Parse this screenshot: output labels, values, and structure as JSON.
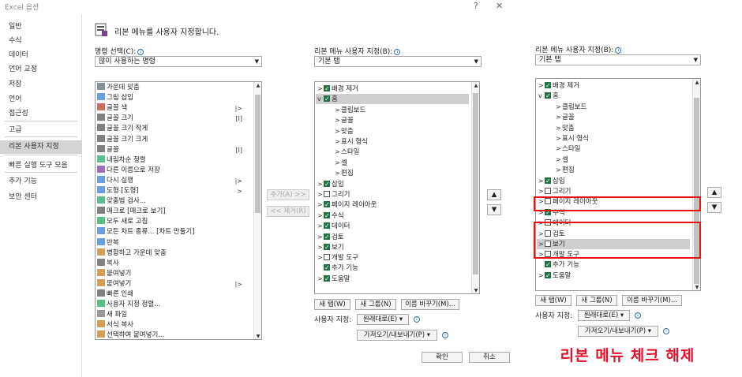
{
  "window": {
    "title": "Excel 옵션",
    "help": "?",
    "close": "✕"
  },
  "sidebar": {
    "items": [
      "일반",
      "수식",
      "데이터",
      "언어 교정",
      "저장",
      "언어",
      "접근성",
      "고급",
      "리본 사용자 지정",
      "빠른 실행 도구 모음",
      "추가 기능",
      "보안 센터"
    ],
    "selected": 8
  },
  "header": {
    "text": "리본 메뉴를 사용자 지정합니다."
  },
  "commands": {
    "label": "명령 선택(C):",
    "combo": "많이 사용하는 명령",
    "items": [
      "가운데 맞춤",
      "그림 삽입",
      "글꼴 색",
      "글꼴 크기",
      "글꼴 크기 작게",
      "글꼴 크기 크게",
      "글꼴",
      "내림차순 정렬",
      "다른 이름으로 저장",
      "다시 실행",
      "도형 [도형]",
      "맞춤법 검사...",
      "매크로 [매크로 보기]",
      "모두 새로 고침",
      "모든 차트 종류... [차트 만들기]",
      "반복",
      "병합하고 가운데 맞춤",
      "복사",
      "붙여넣기",
      "붙여넣기",
      "빠른 인쇄",
      "사용자 지정 정렬...",
      "새 파일",
      "서식 복사",
      "선택하여 붙여넣기..."
    ]
  },
  "middle": {
    "add_btn": "추가(A) >>",
    "remove_btn": "<< 제거(R)"
  },
  "ribbon_left": {
    "label": "리본 메뉴 사용자 지정(B):",
    "combo": "기본 탭",
    "items": [
      {
        "t": "배경 제거",
        "lvl": 0,
        "cb": true,
        "exp": ">"
      },
      {
        "t": "홈",
        "lvl": 0,
        "cb": true,
        "exp": "v",
        "sel": true
      },
      {
        "t": "클립보드",
        "lvl": 1
      },
      {
        "t": "글꼴",
        "lvl": 1
      },
      {
        "t": "맞춤",
        "lvl": 1
      },
      {
        "t": "표시 형식",
        "lvl": 1
      },
      {
        "t": "스타일",
        "lvl": 1
      },
      {
        "t": "셀",
        "lvl": 1
      },
      {
        "t": "편집",
        "lvl": 1
      },
      {
        "t": "삽입",
        "lvl": 0,
        "cb": true,
        "exp": ">"
      },
      {
        "t": "그리기",
        "lvl": 0,
        "cb": false,
        "exp": ">"
      },
      {
        "t": "페이지 레이아웃",
        "lvl": 0,
        "cb": true,
        "exp": ">"
      },
      {
        "t": "수식",
        "lvl": 0,
        "cb": true,
        "exp": ">"
      },
      {
        "t": "데이터",
        "lvl": 0,
        "cb": true,
        "exp": ">"
      },
      {
        "t": "검토",
        "lvl": 0,
        "cb": true,
        "exp": ">"
      },
      {
        "t": "보기",
        "lvl": 0,
        "cb": true,
        "exp": ">"
      },
      {
        "t": "개발 도구",
        "lvl": 0,
        "cb": false,
        "exp": ">"
      },
      {
        "t": "추가 기능",
        "lvl": 0,
        "cb": true,
        "exp": ""
      },
      {
        "t": "도움말",
        "lvl": 0,
        "cb": true,
        "exp": ">"
      }
    ],
    "new_tab": "새 탭(W)",
    "new_group": "새 그룹(N)",
    "rename": "이름 바꾸기(M)...",
    "customize_label": "사용자 지정:",
    "reset": "원래대로(E) ▾",
    "import_export": "가져오기/내보내기(P) ▾"
  },
  "ribbon_right": {
    "label": "리본 메뉴 사용자 지정(B):",
    "combo": "기본 탭",
    "items": [
      {
        "t": "배경 제거",
        "lvl": 0,
        "cb": true,
        "exp": ">"
      },
      {
        "t": "홈",
        "lvl": 0,
        "cb": true,
        "exp": "v"
      },
      {
        "t": "클립보드",
        "lvl": 1
      },
      {
        "t": "글꼴",
        "lvl": 1
      },
      {
        "t": "맞춤",
        "lvl": 1
      },
      {
        "t": "표시 형식",
        "lvl": 1
      },
      {
        "t": "스타일",
        "lvl": 1
      },
      {
        "t": "셀",
        "lvl": 1
      },
      {
        "t": "편집",
        "lvl": 1
      },
      {
        "t": "삽입",
        "lvl": 0,
        "cb": true,
        "exp": ">"
      },
      {
        "t": "그리기",
        "lvl": 0,
        "cb": false,
        "exp": ">"
      },
      {
        "t": "페이지 레이아웃",
        "lvl": 0,
        "cb": false,
        "exp": ">"
      },
      {
        "t": "수식",
        "lvl": 0,
        "cb": true,
        "exp": ">"
      },
      {
        "t": "데이터",
        "lvl": 0,
        "cb": false,
        "exp": ">"
      },
      {
        "t": "검토",
        "lvl": 0,
        "cb": false,
        "exp": ">"
      },
      {
        "t": "보기",
        "lvl": 0,
        "cb": false,
        "exp": ">",
        "sel": true
      },
      {
        "t": "개발 도구",
        "lvl": 0,
        "cb": false,
        "exp": ">"
      },
      {
        "t": "추가 기능",
        "lvl": 0,
        "cb": true,
        "exp": ""
      },
      {
        "t": "도움말",
        "lvl": 0,
        "cb": true,
        "exp": ">"
      }
    ],
    "new_tab": "새 탭(W)",
    "new_group": "새 그룹(N)",
    "rename": "이름 바꾸기(M)...",
    "customize_label": "사용자 지정:",
    "reset": "원래대로(E) ▾",
    "import_export": "가져오기/내보내기(P) ▾"
  },
  "footer": {
    "ok": "확인",
    "cancel": "취소"
  },
  "caption": "리본 메뉴 체크 해제",
  "colors": {
    "checked": "#217346",
    "highlight": "#e11111",
    "caption": "#e8102a"
  }
}
